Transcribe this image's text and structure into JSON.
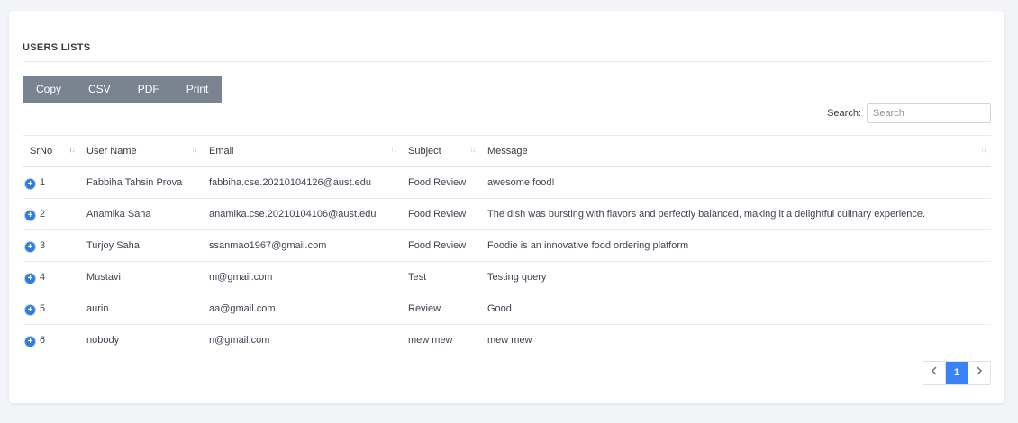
{
  "card": {
    "title": "USERS LISTS"
  },
  "toolbar": {
    "copy": "Copy",
    "csv": "CSV",
    "pdf": "PDF",
    "print": "Print"
  },
  "search": {
    "label": "Search:",
    "placeholder": "Search",
    "value": ""
  },
  "table": {
    "headers": [
      "SrNo",
      "User Name",
      "Email",
      "Subject",
      "Message"
    ],
    "rows": [
      {
        "srno": "1",
        "name": "Fabbiha Tahsin Prova",
        "email": "fabbiha.cse.20210104126@aust.edu",
        "subject": "Food Review",
        "message": "awesome food!"
      },
      {
        "srno": "2",
        "name": "Anamika Saha",
        "email": "anamika.cse.20210104106@aust.edu",
        "subject": "Food Review",
        "message": "The dish was bursting with flavors and perfectly balanced, making it a delightful culinary experience."
      },
      {
        "srno": "3",
        "name": "Turjoy Saha",
        "email": "ssanmao1967@gmail.com",
        "subject": "Food Review",
        "message": "Foodie is an innovative food ordering platform"
      },
      {
        "srno": "4",
        "name": "Mustavi",
        "email": "m@gmail.com",
        "subject": "Test",
        "message": "Testing query"
      },
      {
        "srno": "5",
        "name": "aurin",
        "email": "aa@gmail.com",
        "subject": "Review",
        "message": "Good"
      },
      {
        "srno": "6",
        "name": "nobody",
        "email": "n@gmail.com",
        "subject": "mew mew",
        "message": "mew mew"
      }
    ]
  },
  "pagination": {
    "prev_icon": "chevron-left-icon",
    "current": "1",
    "next_icon": "chevron-right-icon"
  },
  "colors": {
    "accent": "#3b82f6",
    "button_bg": "#7a8390",
    "expand_icon": "#2f7be0"
  }
}
